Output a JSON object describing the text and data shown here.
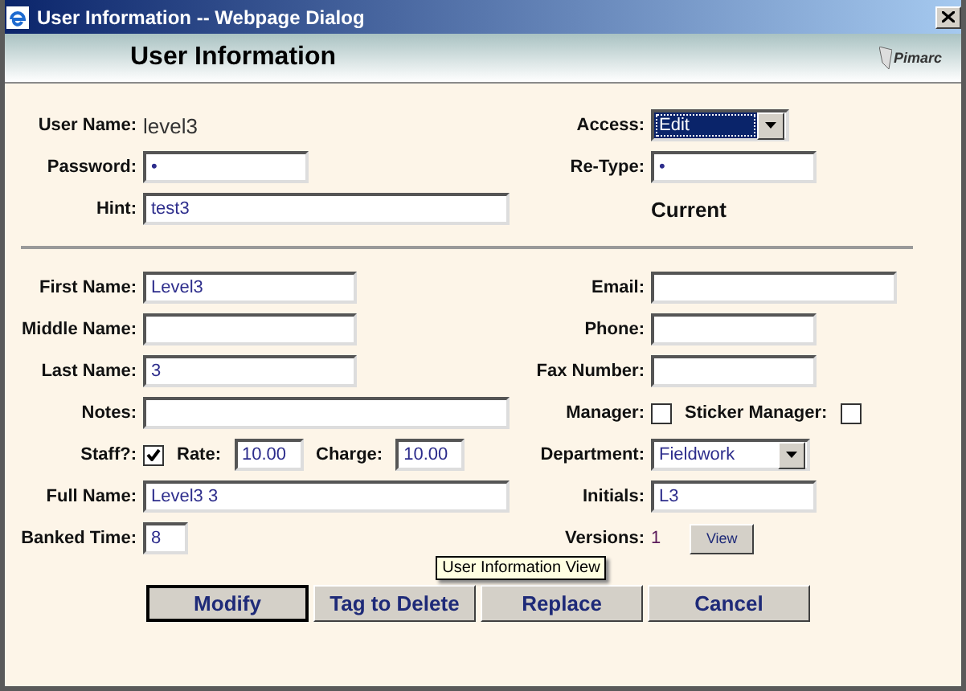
{
  "window": {
    "title": "User Information -- Webpage Dialog"
  },
  "header": {
    "title": "User Information",
    "logo": "Pimarc"
  },
  "top_rows": [
    {
      "left": {
        "label": "User Name:",
        "items": [
          {
            "kind": "text",
            "value": "level3"
          }
        ]
      },
      "right": {
        "label": "Access:",
        "items": [
          {
            "kind": "select",
            "value": "Edit",
            "focused": true
          }
        ]
      }
    },
    {
      "left": {
        "label": "Password:",
        "items": [
          {
            "kind": "input",
            "value": "•"
          }
        ]
      },
      "right": {
        "label": "Re-Type:",
        "items": [
          {
            "kind": "input",
            "value": "•"
          }
        ]
      }
    },
    {
      "left": {
        "label": "Hint:",
        "items": [
          {
            "kind": "input",
            "value": "test3"
          }
        ]
      },
      "right": {
        "items": [
          {
            "kind": "heading",
            "value": "Current"
          }
        ]
      }
    }
  ],
  "rows": [
    {
      "left": {
        "label": "First Name:",
        "items": [
          {
            "kind": "input",
            "value": "Level3"
          }
        ]
      },
      "right": {
        "label": "Email:",
        "items": [
          {
            "kind": "input"
          }
        ]
      }
    },
    {
      "left": {
        "label": "Middle Name:",
        "items": [
          {
            "kind": "input"
          }
        ]
      },
      "right": {
        "label": "Phone:",
        "items": [
          {
            "kind": "input"
          }
        ]
      }
    },
    {
      "left": {
        "label": "Last Name:",
        "items": [
          {
            "kind": "input",
            "value": "3"
          }
        ]
      },
      "right": {
        "label": "Fax Number:",
        "items": [
          {
            "kind": "input"
          }
        ]
      }
    },
    {
      "left": {
        "label": "Notes:",
        "items": [
          {
            "kind": "input"
          }
        ]
      },
      "right": {
        "label": "Manager:",
        "items": [
          {
            "kind": "checkbox",
            "checked": false
          },
          {
            "kind": "label",
            "value": "Sticker Manager:"
          },
          {
            "kind": "checkbox",
            "checked": false
          }
        ]
      }
    },
    {
      "left": {
        "label": "Staff?:",
        "items": [
          {
            "kind": "checkbox",
            "checked": true
          },
          {
            "kind": "label",
            "value": "Rate:"
          },
          {
            "kind": "input",
            "value": "10.00"
          },
          {
            "kind": "label",
            "value": "Charge:"
          },
          {
            "kind": "input",
            "value": "10.00"
          }
        ]
      },
      "right": {
        "label": "Department:",
        "items": [
          {
            "kind": "select",
            "value": "Fieldwork",
            "focused": false
          }
        ]
      }
    },
    {
      "left": {
        "label": "Full Name:",
        "items": [
          {
            "kind": "input",
            "value": "Level3 3"
          }
        ]
      },
      "right": {
        "label": "Initials:",
        "items": [
          {
            "kind": "input",
            "value": "L3"
          }
        ]
      }
    },
    {
      "left": {
        "label": "Banked Time:",
        "items": [
          {
            "kind": "input",
            "value": "8"
          }
        ]
      },
      "right": {
        "label": "Versions:",
        "items": [
          {
            "kind": "count",
            "value": "1"
          },
          {
            "kind": "button",
            "value": "View",
            "tooltip": "User Information View"
          }
        ]
      }
    }
  ],
  "buttons": [
    {
      "label": "Modify",
      "default": true
    },
    {
      "label": "Tag to Delete",
      "default": false
    },
    {
      "label": "Replace",
      "default": false
    },
    {
      "label": "Cancel",
      "default": false
    }
  ]
}
